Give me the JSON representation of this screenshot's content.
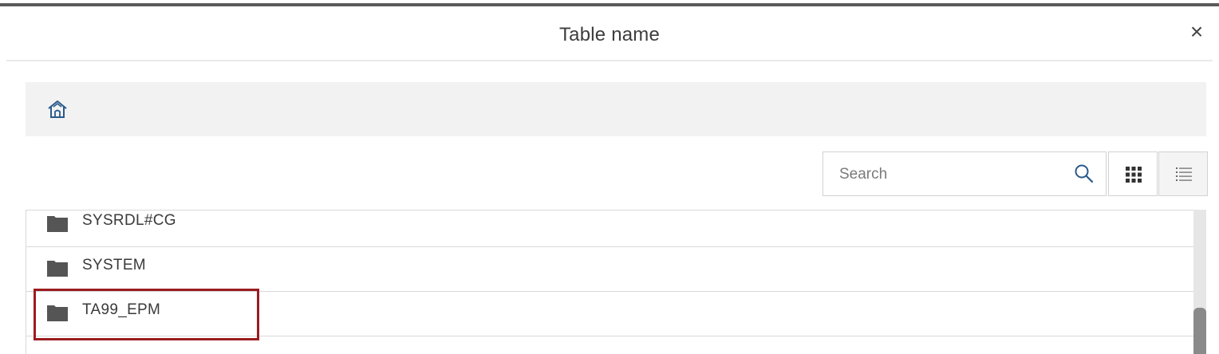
{
  "dialog": {
    "title": "Table name",
    "close_icon": "close-icon",
    "accent_color": "#9b1c1f"
  },
  "breadcrumb": {
    "home_icon": "home-icon"
  },
  "toolbar": {
    "search_placeholder": "Search",
    "search_icon": "search-icon",
    "grid_view_icon": "grid-view-icon",
    "list_view_icon": "list-view-icon",
    "active_view": "list"
  },
  "list": {
    "items": [
      {
        "label": "SYSRDL#CG",
        "icon": "folder-icon"
      },
      {
        "label": "SYSTEM",
        "icon": "folder-icon"
      },
      {
        "label": "TA99_EPM",
        "icon": "folder-icon",
        "highlighted": true
      }
    ]
  }
}
